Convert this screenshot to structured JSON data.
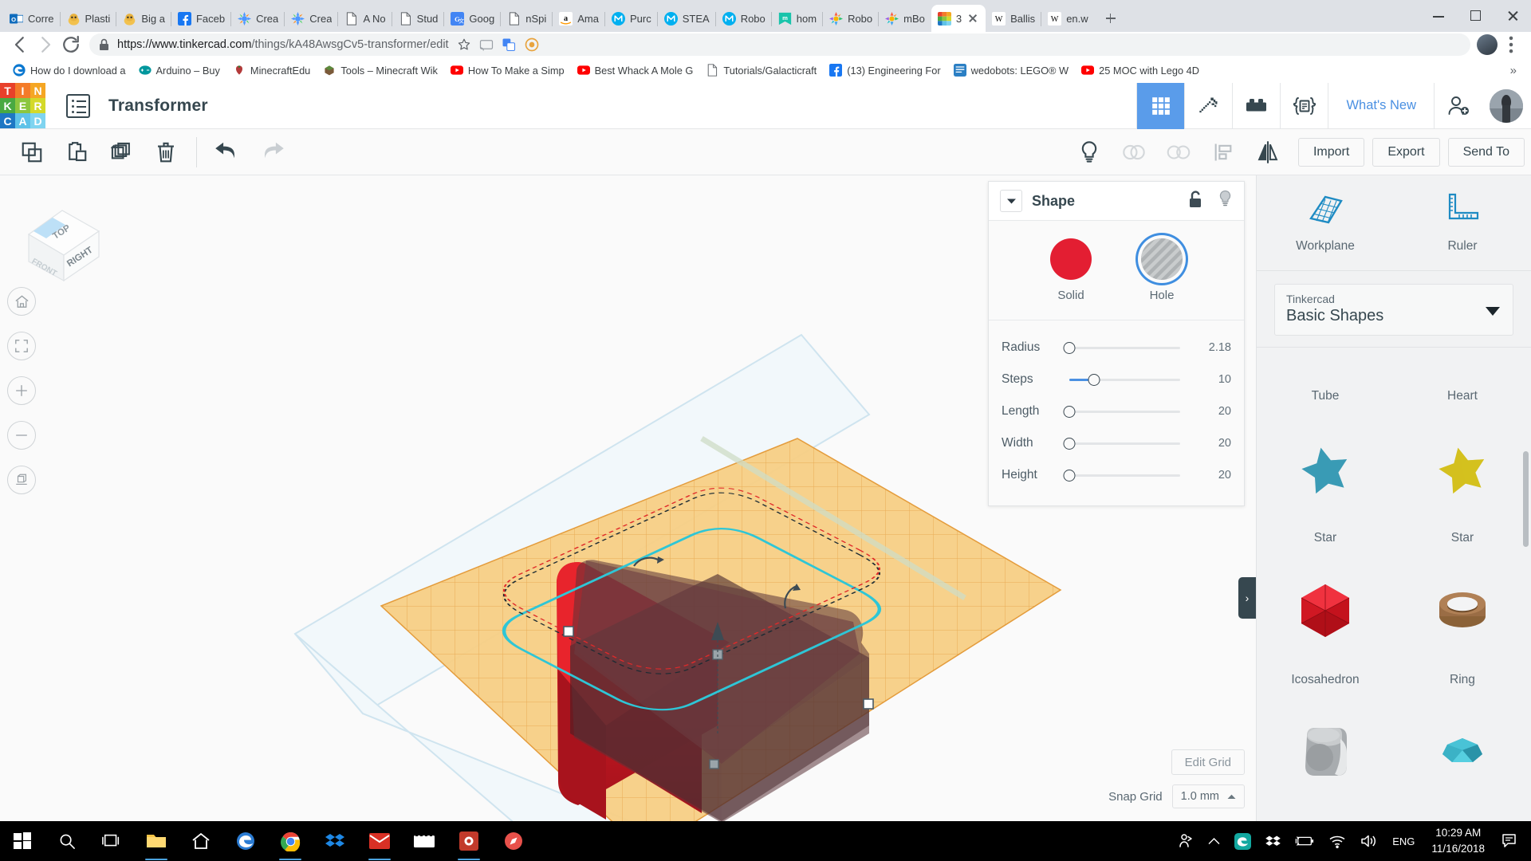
{
  "browser": {
    "tabs": [
      {
        "title": "Corre",
        "icon": "outlook-icon",
        "color": "#0f6cbd"
      },
      {
        "title": "Plasti",
        "icon": "thingiverse-icon",
        "color": "#f5c518"
      },
      {
        "title": "Big a",
        "icon": "thingiverse-icon",
        "color": "#f5c518"
      },
      {
        "title": "Faceb",
        "icon": "facebook-icon",
        "color": "#1877f2"
      },
      {
        "title": "Crea",
        "icon": "scratch-icon",
        "color": "#4c97ff"
      },
      {
        "title": "Crea",
        "icon": "scratch-icon",
        "color": "#4c97ff"
      },
      {
        "title": "A No",
        "icon": "doc-icon",
        "color": "#ffffff"
      },
      {
        "title": "Stud",
        "icon": "doc-icon",
        "color": "#ffffff"
      },
      {
        "title": "Goog",
        "icon": "translate-icon",
        "color": "#4285f4"
      },
      {
        "title": "nSpi",
        "icon": "doc-icon",
        "color": "#ffffff"
      },
      {
        "title": "Ama",
        "icon": "amazon-icon",
        "color": "#ffffff"
      },
      {
        "title": "Purc",
        "icon": "makeblock-icon",
        "color": "#00b0f0"
      },
      {
        "title": "STEA",
        "icon": "makeblock-icon",
        "color": "#00b0f0"
      },
      {
        "title": "Robo",
        "icon": "makeblock-icon",
        "color": "#00b0f0"
      },
      {
        "title": "hom",
        "icon": "mbot-icon",
        "color": "#19c4ab"
      },
      {
        "title": "Robo",
        "icon": "mblock-icon",
        "color": "#ff8a00"
      },
      {
        "title": "mBo",
        "icon": "mblock-icon",
        "color": "#ff8a00"
      },
      {
        "title": "3",
        "icon": "tinkercad-icon",
        "color": "#ffffff",
        "active": true
      },
      {
        "title": "Ballis",
        "icon": "wikipedia-icon",
        "color": "#ffffff"
      },
      {
        "title": "en.w",
        "icon": "wikipedia-icon",
        "color": "#ffffff"
      }
    ],
    "url_secure_label": "https://www.tinkercad.com",
    "url_path": "/things/kA48AwsgCv5-transformer/edit",
    "bookmarks": [
      {
        "label": "How do I download a",
        "icon": "edge-icon",
        "color": "#0b78d0"
      },
      {
        "label": "Arduino – Buy",
        "icon": "arduino-icon",
        "color": "#00979d"
      },
      {
        "label": "MinecraftEdu",
        "icon": "minecraft-edu-icon",
        "color": "#b33a3a"
      },
      {
        "label": "Tools – Minecraft Wik",
        "icon": "minecraft-icon",
        "color": "#5c8a3c"
      },
      {
        "label": "How To Make a Simp",
        "icon": "youtube-icon",
        "color": "#ff0000"
      },
      {
        "label": "Best Whack A Mole G",
        "icon": "youtube-icon",
        "color": "#ff0000"
      },
      {
        "label": "Tutorials/Galacticraft",
        "icon": "doc-icon",
        "color": "#ffffff"
      },
      {
        "label": "(13) Engineering For",
        "icon": "facebook-icon",
        "color": "#1877f2"
      },
      {
        "label": "wedobots: LEGO® W",
        "icon": "blog-icon",
        "color": "#2b7fc4"
      },
      {
        "label": "25 MOC with Lego 4D",
        "icon": "youtube-icon",
        "color": "#ff0000"
      }
    ],
    "bookmarks_overflow": "»"
  },
  "app": {
    "logo_letters": [
      "T",
      "I",
      "N",
      "K",
      "E",
      "R",
      "C",
      "A",
      "D"
    ],
    "logo_colors": [
      "#e8402a",
      "#f47b29",
      "#f5a623",
      "#49a942",
      "#8cc63f",
      "#d4d92a",
      "#1e77c4",
      "#5ec2e8",
      "#7fd4f0"
    ],
    "design_name": "Transformer",
    "top_icons": [
      {
        "name": "grid-view-icon",
        "selected": true
      },
      {
        "name": "minecraft-pickaxe-icon",
        "selected": false
      },
      {
        "name": "blocks-brick-icon",
        "selected": false
      },
      {
        "name": "codeblocks-icon",
        "selected": false
      }
    ],
    "whats_new": "What's New",
    "toolbar_icons": [
      "copy-icon",
      "paste-icon",
      "duplicate-icon",
      "delete-icon",
      "undo-icon",
      "redo-icon"
    ],
    "toolbar_right_icons": [
      "lightbulb-icon",
      "group-icon",
      "ungroup-icon",
      "align-icon",
      "mirror-icon"
    ],
    "buttons": {
      "import": "Import",
      "export": "Export",
      "send_to": "Send To"
    },
    "viewcube": {
      "top": "TOP",
      "front": "FRONT",
      "right": "RIGHT"
    },
    "view_controls": [
      "home-icon",
      "fit-icon",
      "zoom-in-icon",
      "zoom-out-icon",
      "ortho-icon"
    ]
  },
  "shape_panel": {
    "title": "Shape",
    "lock_icon": "unlock-icon",
    "light_icon": "lightbulb-icon",
    "collapse_icon": "chevron-down-icon",
    "modes": [
      {
        "label": "Solid",
        "color": "#e31e32",
        "selected": false
      },
      {
        "label": "Hole",
        "color": "#b3b3b3",
        "selected": true
      }
    ],
    "sliders": [
      {
        "label": "Radius",
        "value": "2.18",
        "fill_pct": 0
      },
      {
        "label": "Steps",
        "value": "10",
        "fill_pct": 22
      },
      {
        "label": "Length",
        "value": "20",
        "fill_pct": 0
      },
      {
        "label": "Width",
        "value": "20",
        "fill_pct": 0
      },
      {
        "label": "Height",
        "value": "20",
        "fill_pct": 0
      }
    ]
  },
  "grid_footer": {
    "edit_grid": "Edit Grid",
    "snap_grid_label": "Snap Grid",
    "snap_grid_value": "1.0 mm"
  },
  "right_panel": {
    "collapse_handle": "›",
    "tools": [
      {
        "label": "Workplane",
        "icon": "workplane-icon"
      },
      {
        "label": "Ruler",
        "icon": "ruler-icon"
      }
    ],
    "library_vendor": "Tinkercad",
    "library_name": "Basic Shapes",
    "shapes": [
      {
        "label": "Tube",
        "icon": "tube-shape",
        "color": "#9aa0a6"
      },
      {
        "label": "Heart",
        "icon": "heart-shape",
        "color": "#e05a6a"
      },
      {
        "label": "Star",
        "icon": "star-shape",
        "color": "#3a9bb5"
      },
      {
        "label": "Star",
        "icon": "star-shape",
        "color": "#d4c01e"
      },
      {
        "label": "Icosahedron",
        "icon": "icosahedron-shape",
        "color": "#e01f2d"
      },
      {
        "label": "Ring",
        "icon": "ring-shape",
        "color": "#9a6d45"
      },
      {
        "label": "Dice",
        "icon": "dice-shape",
        "color": "#a8acaf"
      },
      {
        "label": "Diamond",
        "icon": "diamond-shape",
        "color": "#35b6c9"
      }
    ]
  },
  "taskbar": {
    "items": [
      "start-icon",
      "search-icon",
      "task-view-icon",
      "file-explorer-icon",
      "home-icon",
      "edge-icon",
      "chrome-icon",
      "dropbox-icon",
      "mail-icon",
      "media-icon",
      "record-icon",
      "compass-icon"
    ],
    "tray": [
      "people-icon",
      "chevron-up-icon",
      "edge-tray-icon",
      "dropbox-tray-icon",
      "battery-icon",
      "wifi-icon",
      "volume-icon"
    ],
    "language": "ENG",
    "time": "10:29 AM",
    "date": "11/16/2018",
    "notification_icon": "notification-icon"
  }
}
